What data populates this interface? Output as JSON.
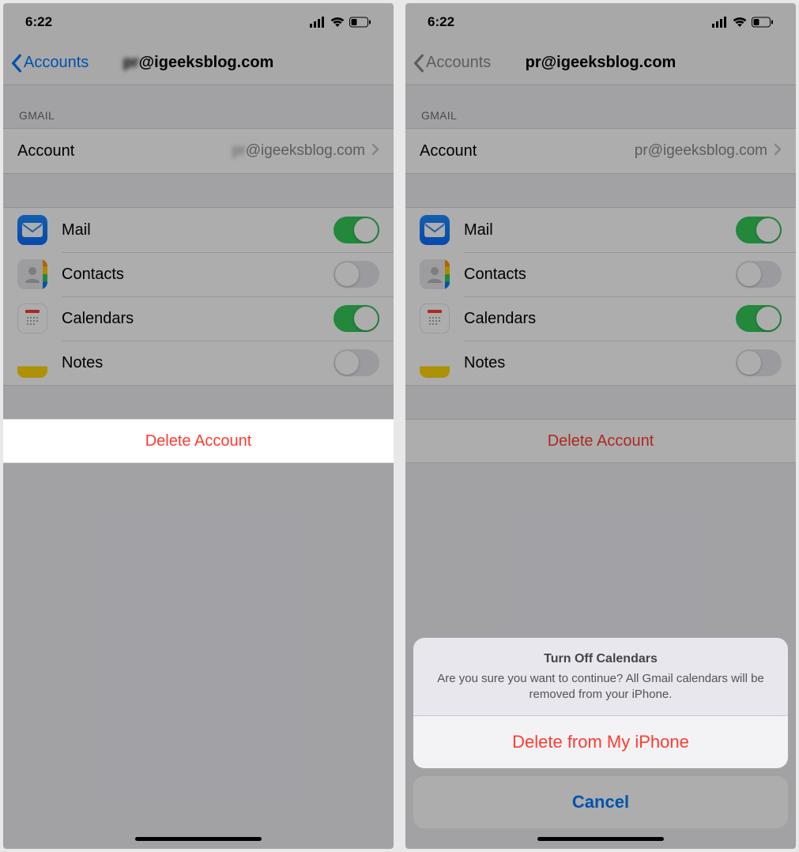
{
  "left": {
    "status": {
      "time": "6:22"
    },
    "nav": {
      "back": "Accounts",
      "title_prefix": "",
      "title_email": "@igeeksblog.com"
    },
    "section1_header": "GMAIL",
    "account": {
      "label": "Account",
      "value_prefix": "",
      "value_email": "@igeeksblog.com"
    },
    "toggles": {
      "mail": {
        "label": "Mail",
        "on": true
      },
      "contacts": {
        "label": "Contacts",
        "on": false
      },
      "calendars": {
        "label": "Calendars",
        "on": true
      },
      "notes": {
        "label": "Notes",
        "on": false
      }
    },
    "delete": "Delete Account"
  },
  "right": {
    "status": {
      "time": "6:22"
    },
    "nav": {
      "back": "Accounts",
      "title": "pr@igeeksblog.com"
    },
    "section1_header": "GMAIL",
    "account": {
      "label": "Account",
      "value": "pr@igeeksblog.com"
    },
    "toggles": {
      "mail": {
        "label": "Mail",
        "on": true
      },
      "contacts": {
        "label": "Contacts",
        "on": false
      },
      "calendars": {
        "label": "Calendars",
        "on": true
      },
      "notes": {
        "label": "Notes",
        "on": false
      }
    },
    "delete": "Delete Account",
    "sheet": {
      "title": "Turn Off Calendars",
      "message": "Are you sure you want to continue? All Gmail calendars will be removed from your iPhone.",
      "destructive": "Delete from My iPhone",
      "cancel": "Cancel"
    }
  }
}
